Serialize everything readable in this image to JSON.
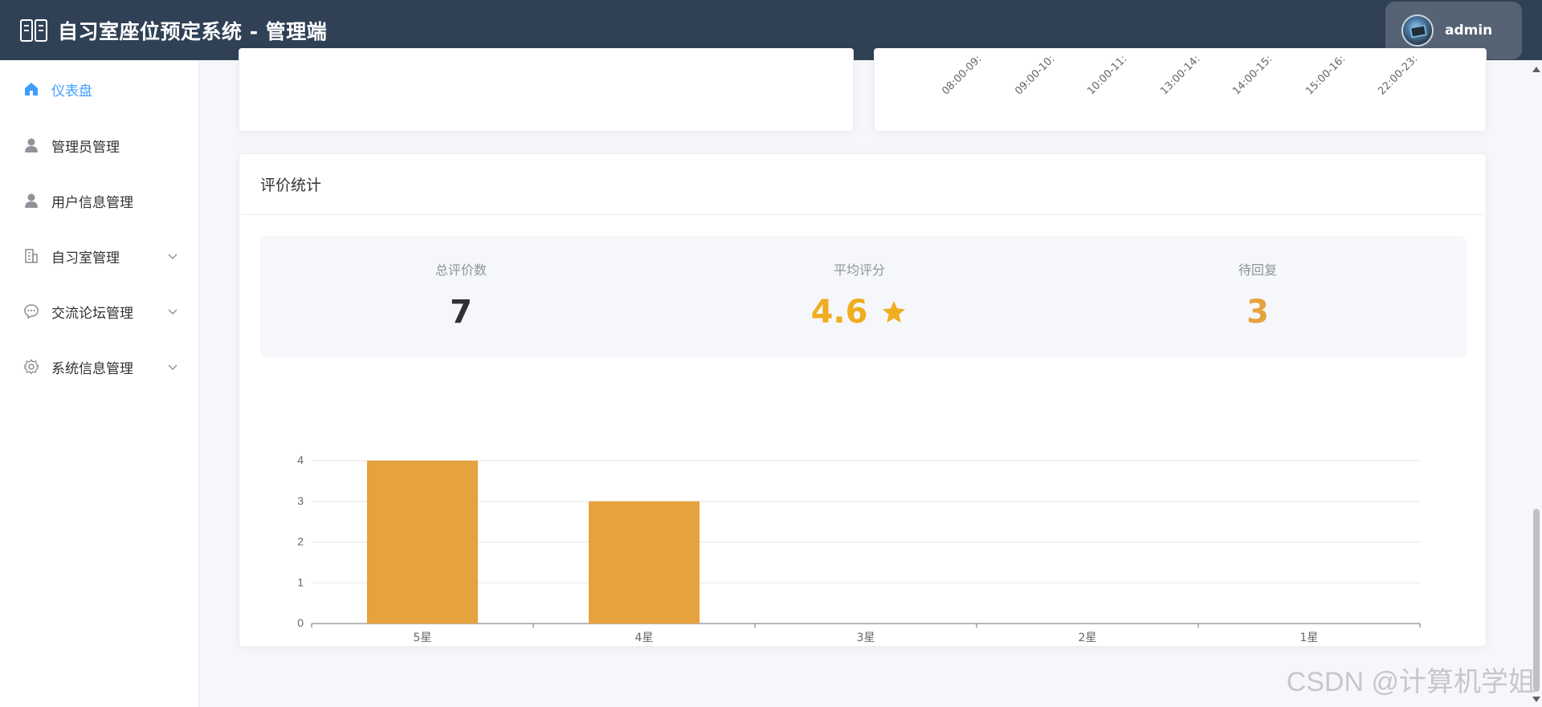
{
  "header": {
    "title": "自习室座位预定系统 - 管理端",
    "username": "admin"
  },
  "sidebar": {
    "items": [
      {
        "label": "仪表盘",
        "icon": "home-icon",
        "active": true
      },
      {
        "label": "管理员管理",
        "icon": "user-icon"
      },
      {
        "label": "用户信息管理",
        "icon": "user-icon"
      },
      {
        "label": "自习室管理",
        "icon": "building-icon",
        "expandable": true
      },
      {
        "label": "交流论坛管理",
        "icon": "chat-icon",
        "expandable": true
      },
      {
        "label": "系统信息管理",
        "icon": "gear-icon",
        "expandable": true
      }
    ]
  },
  "time_slots": [
    "08:00-09:",
    "09:00-10:",
    "10:00-11:",
    "13:00-14:",
    "14:00-15:",
    "15:00-16:",
    "22:00-23:"
  ],
  "evaluation": {
    "title": "评价统计",
    "total_label": "总评价数",
    "total_value": "7",
    "avg_label": "平均评分",
    "avg_value": "4.6",
    "pending_label": "待回复",
    "pending_value": "3"
  },
  "colors": {
    "header_bg": "#304156",
    "active": "#409eff",
    "bar": "#e6a23c",
    "rating": "#f0ad1f",
    "pending": "#e6a23c"
  },
  "chart_data": {
    "type": "bar",
    "categories": [
      "5星",
      "4星",
      "3星",
      "2星",
      "1星"
    ],
    "values": [
      4,
      3,
      0,
      0,
      0
    ],
    "ylim": [
      0,
      4
    ],
    "yticks": [
      0,
      1,
      2,
      3,
      4
    ],
    "grid": true
  },
  "watermark": "CSDN @计算机学姐"
}
